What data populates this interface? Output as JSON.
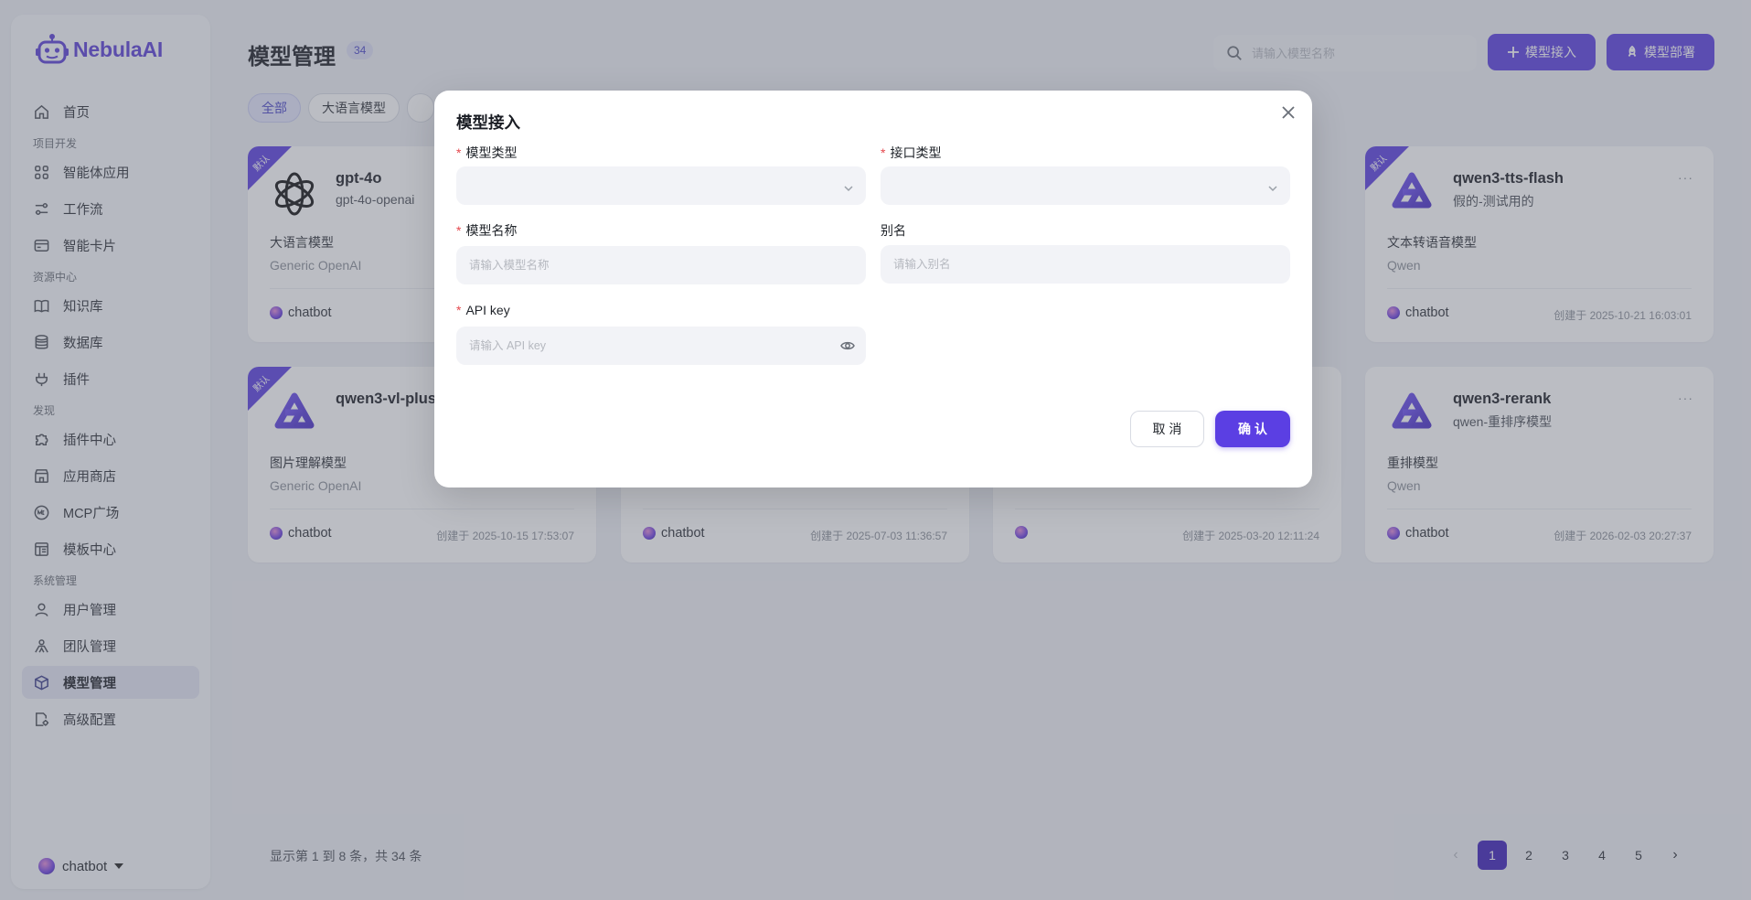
{
  "brand": {
    "name": "NebulaAI"
  },
  "sidebar": {
    "items": [
      {
        "label": "首页",
        "icon": "home-icon"
      },
      {
        "section": "项目开发"
      },
      {
        "label": "智能体应用",
        "icon": "grid-icon"
      },
      {
        "label": "工作流",
        "icon": "workflow-icon"
      },
      {
        "label": "智能卡片",
        "icon": "card-icon"
      },
      {
        "section": "资源中心"
      },
      {
        "label": "知识库",
        "icon": "book-icon"
      },
      {
        "label": "数据库",
        "icon": "database-icon"
      },
      {
        "label": "插件",
        "icon": "plug-icon"
      },
      {
        "section": "发现"
      },
      {
        "label": "插件中心",
        "icon": "puzzle-icon"
      },
      {
        "label": "应用商店",
        "icon": "store-icon"
      },
      {
        "label": "MCP广场",
        "icon": "mcp-icon"
      },
      {
        "label": "模板中心",
        "icon": "template-icon"
      },
      {
        "section": "系统管理"
      },
      {
        "label": "用户管理",
        "icon": "user-icon"
      },
      {
        "label": "团队管理",
        "icon": "team-icon"
      },
      {
        "label": "模型管理",
        "icon": "cube-icon",
        "active": true
      },
      {
        "label": "高级配置",
        "icon": "settings-doc-icon"
      }
    ],
    "user": "chatbot"
  },
  "header": {
    "title": "模型管理",
    "count": "34",
    "search_placeholder": "请输入模型名称",
    "btn_access": "模型接入",
    "btn_deploy": "模型部署"
  },
  "filters": [
    "全部",
    "大语言模型"
  ],
  "cards": [
    {
      "badge": "默认",
      "name": "gpt-4o",
      "sub": "gpt-4o-openai",
      "type": "大语言模型",
      "provider": "Generic OpenAI",
      "owner": "chatbot",
      "created": "",
      "logo": "openai"
    },
    {
      "badge": "默认",
      "name": "qwen3-tts-flash",
      "sub": "假的-测试用的",
      "type": "文本转语音模型",
      "provider": "Qwen",
      "owner": "chatbot",
      "created": "创建于 2025-10-21 16:03:01",
      "logo": "qwen"
    },
    {
      "badge": "默认",
      "name": "qwen3-vl-plus",
      "sub": "",
      "type": "图片理解模型",
      "provider": "Generic OpenAI",
      "owner": "chatbot",
      "created": "创建于 2025-10-15 17:53:07",
      "logo": "qwen"
    },
    {
      "badge": "",
      "name": "",
      "sub": "",
      "type": "",
      "provider": "",
      "owner": "chatbot",
      "created": "创建于 2025-07-03 11:36:57",
      "logo": ""
    },
    {
      "badge": "",
      "name": "",
      "sub": "",
      "type": "",
      "provider": "",
      "owner": "",
      "created": "创建于 2025-03-20 12:11:24",
      "logo": ""
    },
    {
      "badge": "",
      "name": "qwen3-rerank",
      "sub": "qwen-重排序模型",
      "type": "重排模型",
      "provider": "Qwen",
      "owner": "chatbot",
      "created": "创建于 2026-02-03 20:27:37",
      "logo": "qwen"
    }
  ],
  "footer": {
    "info": "显示第 1 到 8 条，共 34 条",
    "pages": [
      "1",
      "2",
      "3",
      "4",
      "5"
    ],
    "prev": "‹",
    "next": "›"
  },
  "modal": {
    "title": "模型接入",
    "model_type_label": "模型类型",
    "interface_type_label": "接口类型",
    "model_name_label": "模型名称",
    "model_name_placeholder": "请输入模型名称",
    "alias_label": "别名",
    "alias_placeholder": "请输入别名",
    "api_key_label": "API key",
    "api_key_placeholder": "请输入 API key",
    "cancel": "取 消",
    "confirm": "确 认"
  },
  "colors": {
    "accent": "#5a3ee0",
    "active_page": "#3d1fb8",
    "required": "#e5484d"
  }
}
